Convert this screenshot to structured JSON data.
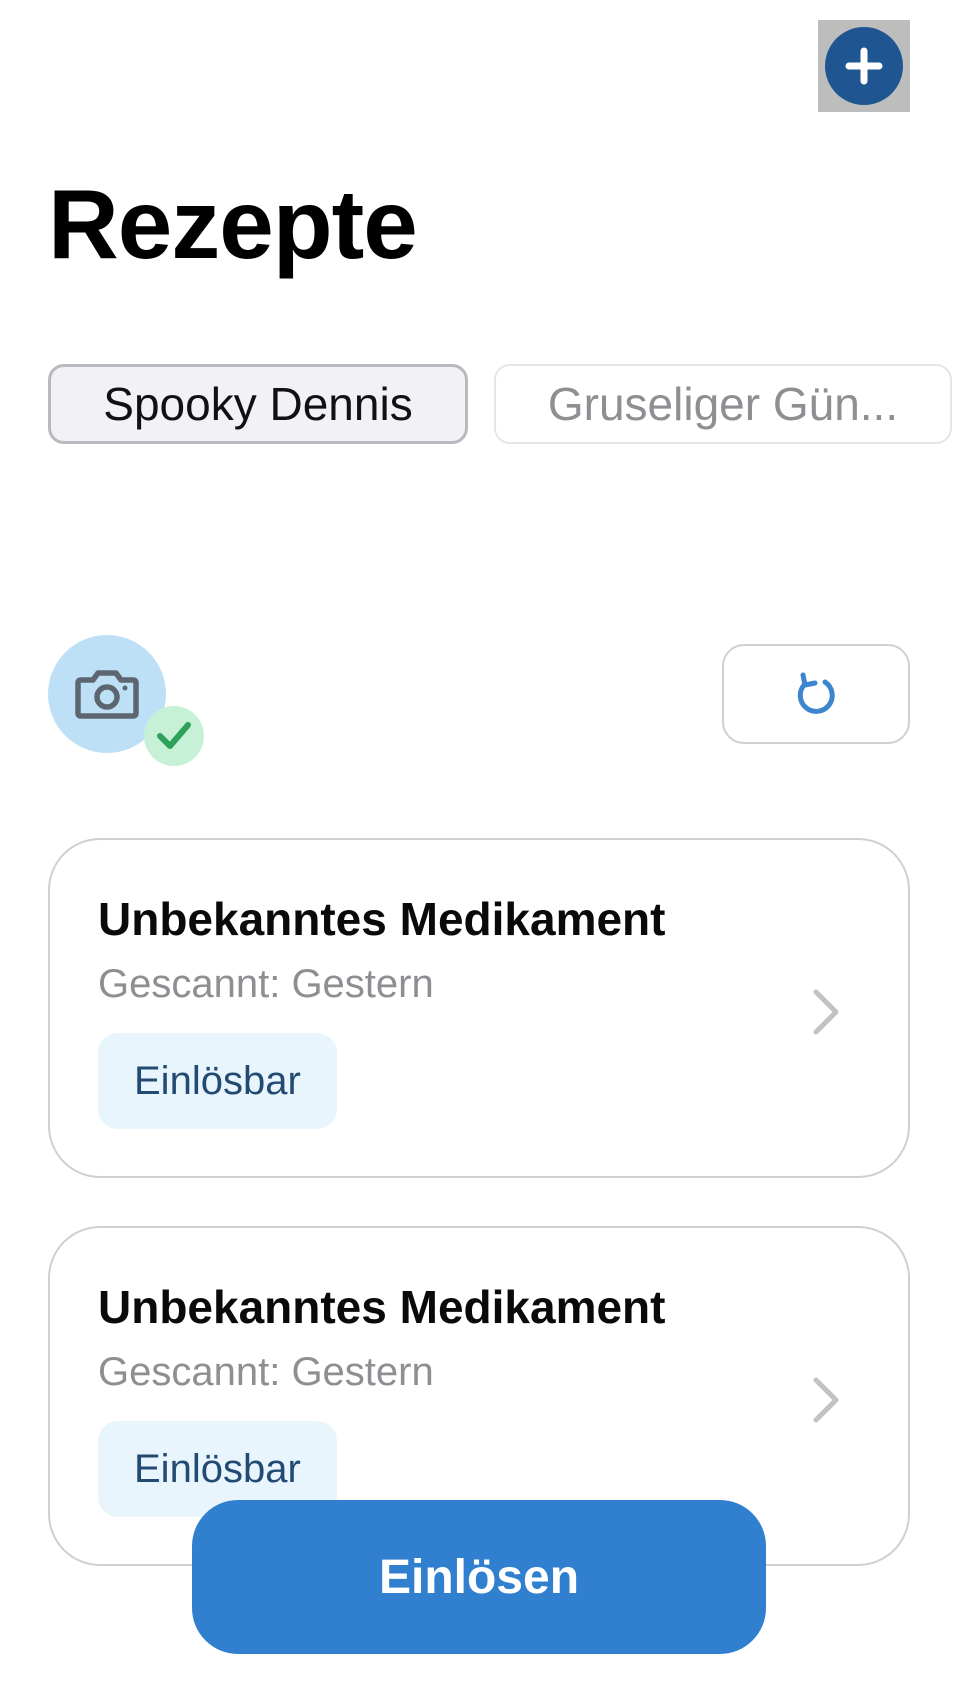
{
  "header": {
    "add_icon": "plus-icon",
    "title": "Rezepte"
  },
  "profiles": {
    "selected": "Spooky Dennis",
    "items": [
      {
        "label": "Spooky Dennis"
      },
      {
        "label": "Gruseliger Gün..."
      }
    ]
  },
  "scan": {
    "camera_icon": "camera-icon",
    "status_icon": "checkmark-icon",
    "refresh_icon": "refresh-icon"
  },
  "prescriptions": [
    {
      "title": "Unbekanntes Medikament",
      "scanned": "Gescannt: Gestern",
      "status": "Einlösbar"
    },
    {
      "title": "Unbekanntes Medikament",
      "scanned": "Gescannt: Gestern",
      "status": "Einlösbar"
    }
  ],
  "action": {
    "label": "Einlösen"
  },
  "colors": {
    "primary": "#3080cf",
    "add_button": "#1f5591",
    "badge_bg": "#e8f5fd",
    "badge_text": "#234a72",
    "camera_bg": "#bee0f6",
    "check_bg": "#c6f1d6",
    "check": "#2ea25a"
  }
}
